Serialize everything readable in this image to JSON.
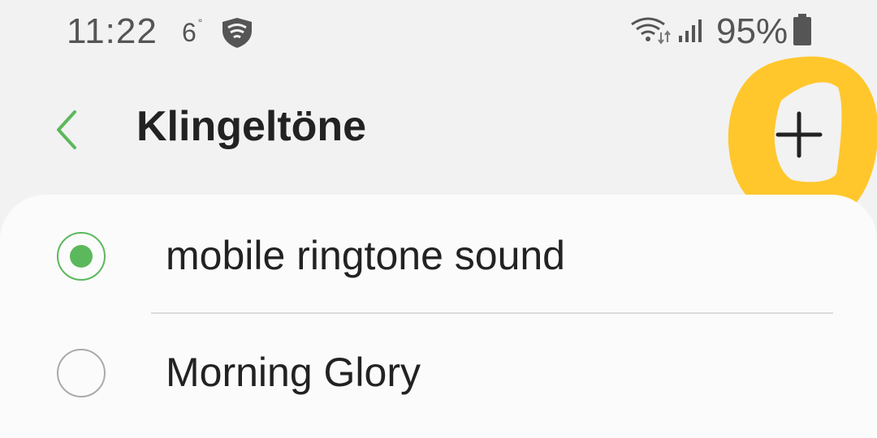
{
  "status_bar": {
    "time": "11:22",
    "temperature": "6",
    "temperature_unit": "°",
    "battery_percent": "95%",
    "icons": [
      "shield-icon",
      "wifi-icon",
      "signal-icon",
      "battery-icon"
    ]
  },
  "app_bar": {
    "title": "Klingeltöne",
    "back_icon": "chevron-left-icon",
    "add_icon": "plus-icon"
  },
  "ringtones": [
    {
      "label": "mobile ringtone sound",
      "selected": true
    },
    {
      "label": "Morning Glory",
      "selected": false
    }
  ],
  "colors": {
    "accent": "#5cb85c",
    "highlight": "#ffc72c",
    "background": "#f2f2f2",
    "card": "#fbfbfb"
  }
}
